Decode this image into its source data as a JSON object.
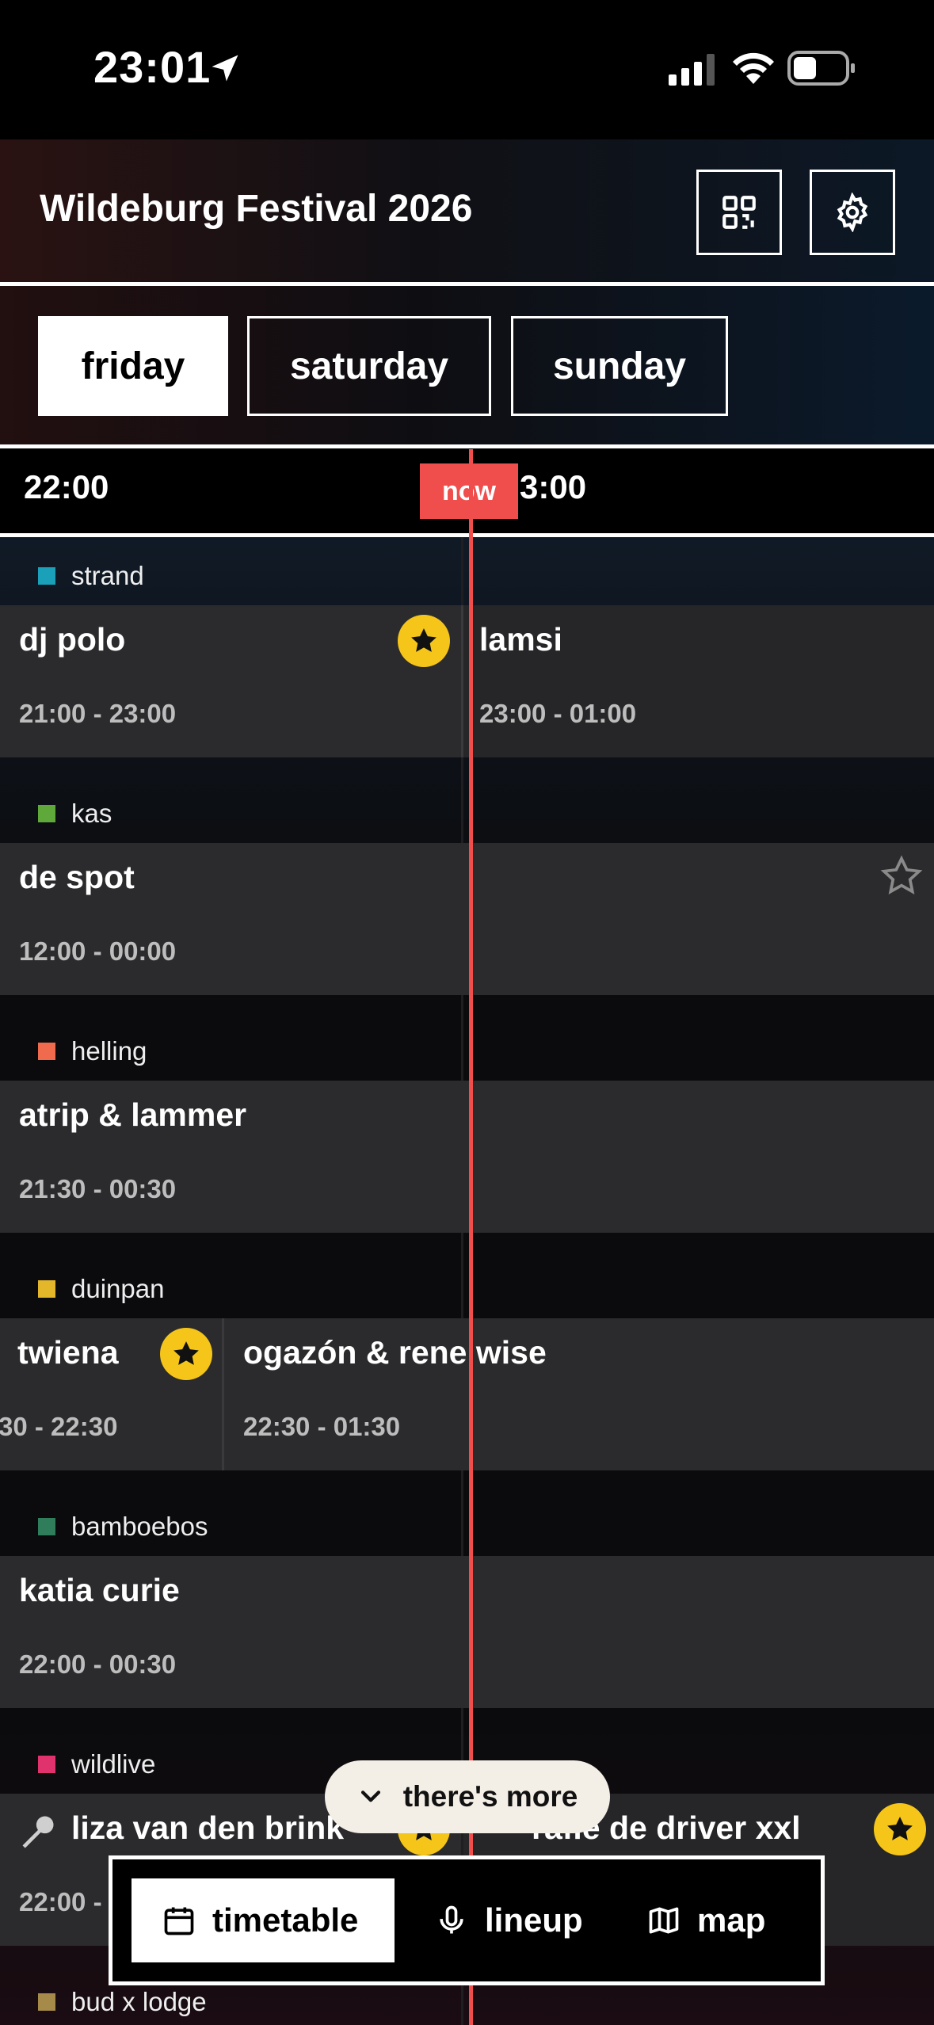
{
  "status_bar": {
    "time": "23:01"
  },
  "header": {
    "title": "Wildeburg Festival 2026"
  },
  "day_tabs": [
    {
      "label": "friday",
      "active": true
    },
    {
      "label": "saturday",
      "active": false
    },
    {
      "label": "sunday",
      "active": false
    }
  ],
  "time_header": {
    "left_time": "22:00",
    "right_time": "3:00",
    "now_label": "now"
  },
  "stages": [
    {
      "name": "strand",
      "color": "#1aa0b8"
    },
    {
      "name": "kas",
      "color": "#5fa83a"
    },
    {
      "name": "helling",
      "color": "#f06a4e"
    },
    {
      "name": "duinpan",
      "color": "#e4b62a"
    },
    {
      "name": "bamboebos",
      "color": "#2f7d5a"
    },
    {
      "name": "wildlive",
      "color": "#e0336e"
    },
    {
      "name": "bud x lodge",
      "color": "#a58a4a"
    }
  ],
  "sets": {
    "strand_1": {
      "name": "dj polo",
      "time": "21:00 - 23:00",
      "favorite": true
    },
    "strand_2": {
      "name": "lamsi",
      "time": "23:00 - 01:00",
      "favorite": false
    },
    "kas_1": {
      "name": "de spot",
      "time": "12:00 - 00:00",
      "favorite": false
    },
    "helling_1": {
      "name": "atrip & lammer",
      "time": "21:30 - 00:30",
      "favorite": false
    },
    "duinpan_1": {
      "name": "twiena",
      "time": "30 - 22:30",
      "favorite": true
    },
    "duinpan_2": {
      "name": "ogazón & rene wise",
      "time": "22:30 - 01:30",
      "favorite": false
    },
    "bamboebos_1": {
      "name": "katia curie",
      "time": "22:00 - 00:30",
      "favorite": false
    },
    "wildlive_1": {
      "name": "liza van den brink",
      "time": "22:00 -",
      "favorite": true
    },
    "wildlive_2": {
      "name": "rafie de driver xxl",
      "time": "",
      "favorite": true
    }
  },
  "more_pill": {
    "label": "there's more"
  },
  "bottom_nav": [
    {
      "label": "timetable",
      "icon": "calendar-icon",
      "active": true
    },
    {
      "label": "lineup",
      "icon": "microphone-icon",
      "active": false
    },
    {
      "label": "map",
      "icon": "map-icon",
      "active": false
    }
  ],
  "colors": {
    "now": "#f04d4d",
    "favorite": "#f6c519"
  }
}
